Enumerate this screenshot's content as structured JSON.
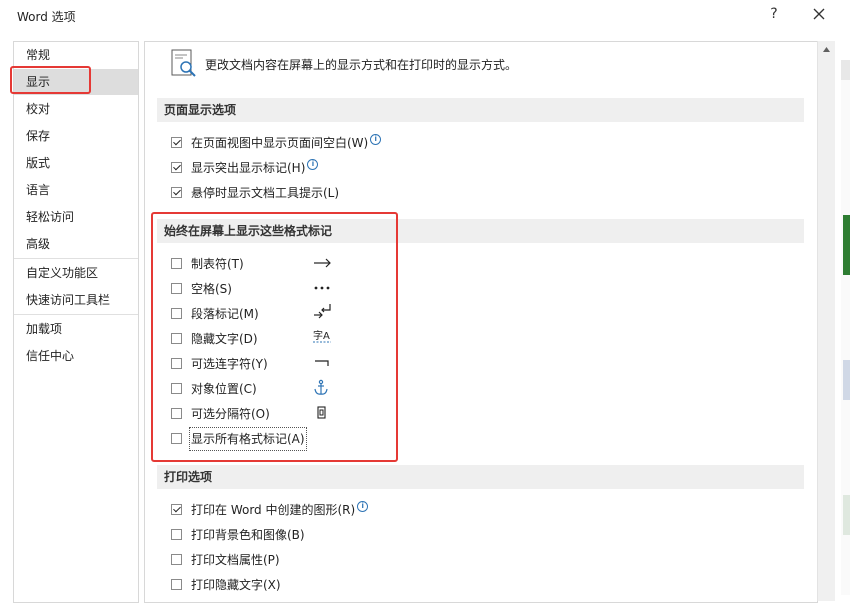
{
  "window": {
    "title": "Word 选项",
    "help_label": "?"
  },
  "sidebar": {
    "items": [
      {
        "label": "常规"
      },
      {
        "label": "显示"
      },
      {
        "label": "校对"
      },
      {
        "label": "保存"
      },
      {
        "label": "版式"
      },
      {
        "label": "语言"
      },
      {
        "label": "轻松访问"
      },
      {
        "label": "高级"
      },
      {
        "label": "自定义功能区"
      },
      {
        "label": "快速访问工具栏"
      },
      {
        "label": "加载项"
      },
      {
        "label": "信任中心"
      }
    ],
    "selected": "显示"
  },
  "main": {
    "header": "更改文档内容在屏幕上的显示方式和在打印时的显示方式。",
    "page_display": {
      "title": "页面显示选项",
      "options": [
        {
          "label": "在页面视图中显示页面间空白(W)",
          "checked": true,
          "info": true
        },
        {
          "label": "显示突出显示标记(H)",
          "checked": true,
          "info": true
        },
        {
          "label": "悬停时显示文档工具提示(L)",
          "checked": true,
          "info": false
        }
      ]
    },
    "formatting_marks": {
      "title": "始终在屏幕上显示这些格式标记",
      "options": [
        {
          "label": "制表符(T)",
          "checked": false,
          "symbol": "tab-arrow-icon"
        },
        {
          "label": "空格(S)",
          "checked": false,
          "symbol": "space-dots-icon"
        },
        {
          "label": "段落标记(M)",
          "checked": false,
          "symbol": "paragraph-mark-icon"
        },
        {
          "label": "隐藏文字(D)",
          "checked": false,
          "symbol": "hidden-text-icon",
          "symbol_text": "字A"
        },
        {
          "label": "可选连字符(Y)",
          "checked": false,
          "symbol": "optional-hyphen-icon"
        },
        {
          "label": "对象位置(C)",
          "checked": false,
          "symbol": "anchor-icon"
        },
        {
          "label": "可选分隔符(O)",
          "checked": false,
          "symbol": "optional-break-icon"
        },
        {
          "label": "显示所有格式标记(A)",
          "checked": false
        }
      ]
    },
    "print": {
      "title": "打印选项",
      "options": [
        {
          "label": "打印在 Word 中创建的图形(R)",
          "checked": true,
          "info": true
        },
        {
          "label": "打印背景色和图像(B)",
          "checked": false,
          "info": false
        },
        {
          "label": "打印文档属性(P)",
          "checked": false,
          "info": false
        },
        {
          "label": "打印隐藏文字(X)",
          "checked": false,
          "info": false
        }
      ]
    }
  },
  "info_glyph": "i",
  "colors": {
    "highlight_red": "#e53935",
    "selected_nav": "#dddddd",
    "section_bg": "#efefef",
    "accent_blue": "#2e74b5"
  }
}
